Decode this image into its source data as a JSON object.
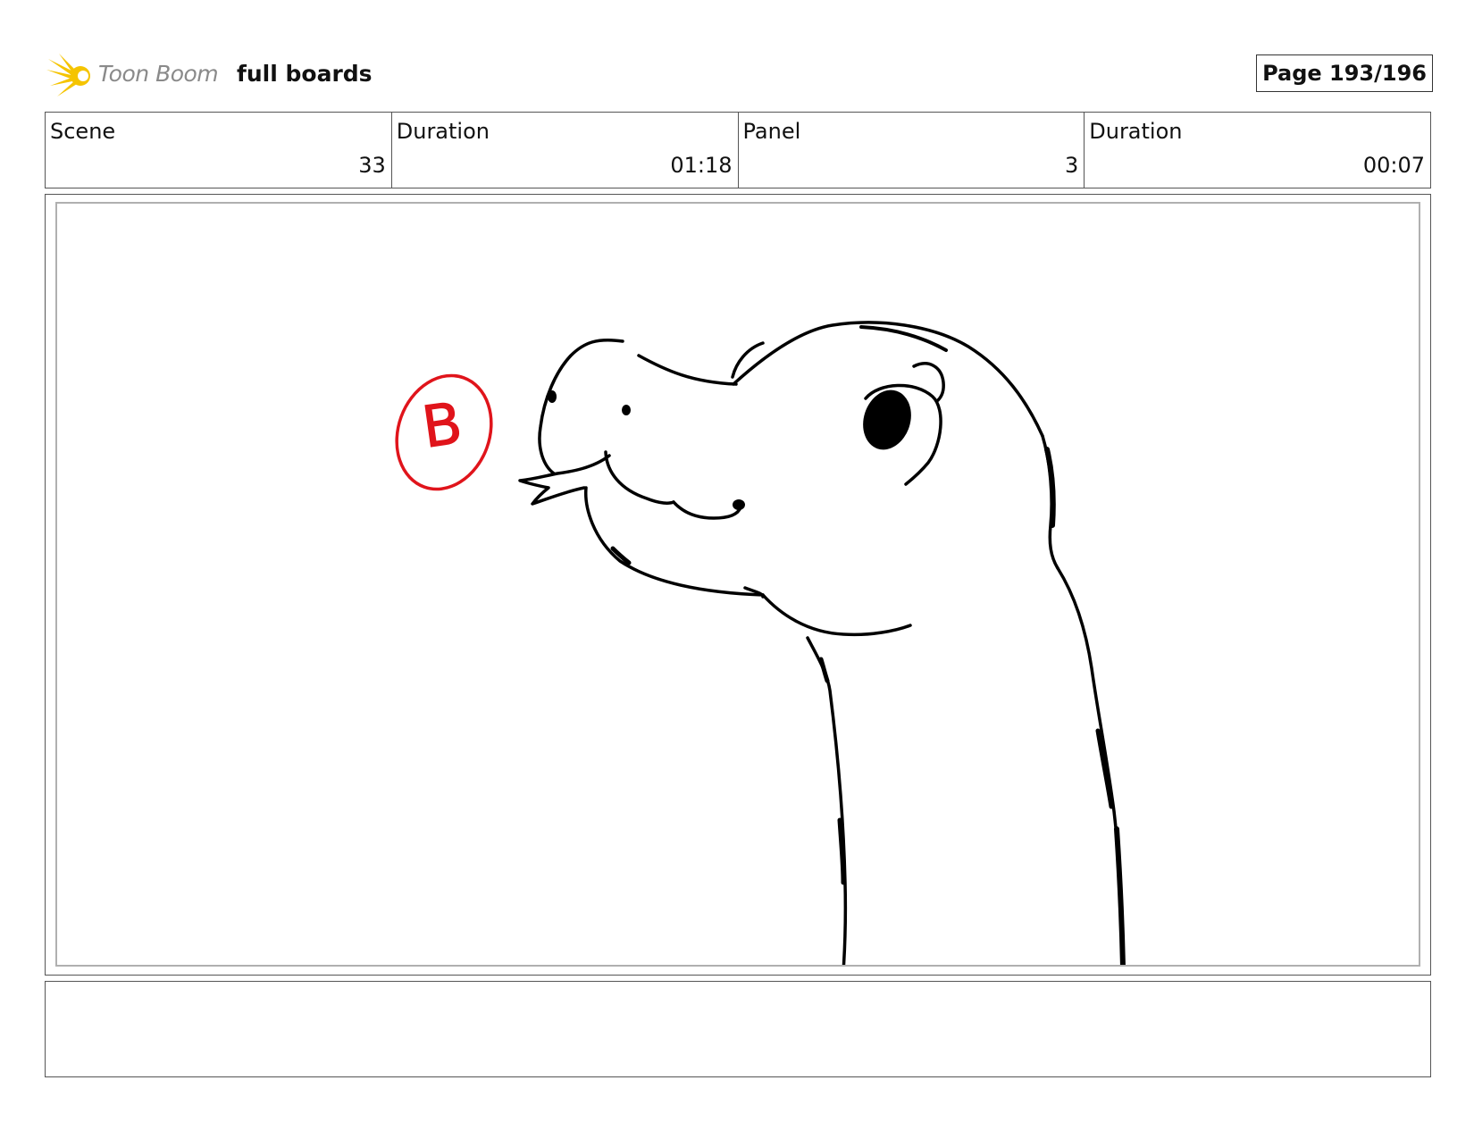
{
  "header": {
    "brand": "Toon Boom",
    "title": "full boards",
    "page_label": "Page 193/196"
  },
  "info": {
    "scene_label": "Scene",
    "scene_value": "33",
    "scene_duration_label": "Duration",
    "scene_duration_value": "01:18",
    "panel_label": "Panel",
    "panel_value": "3",
    "panel_duration_label": "Duration",
    "panel_duration_value": "00:07"
  },
  "drawing": {
    "annotation_letter": "B",
    "annotation_color": "#e0141b",
    "line_color": "#000000"
  },
  "caption": {
    "text": ""
  },
  "colors": {
    "logo_yellow": "#f5c400",
    "brand_gray": "#8a8a8a"
  }
}
